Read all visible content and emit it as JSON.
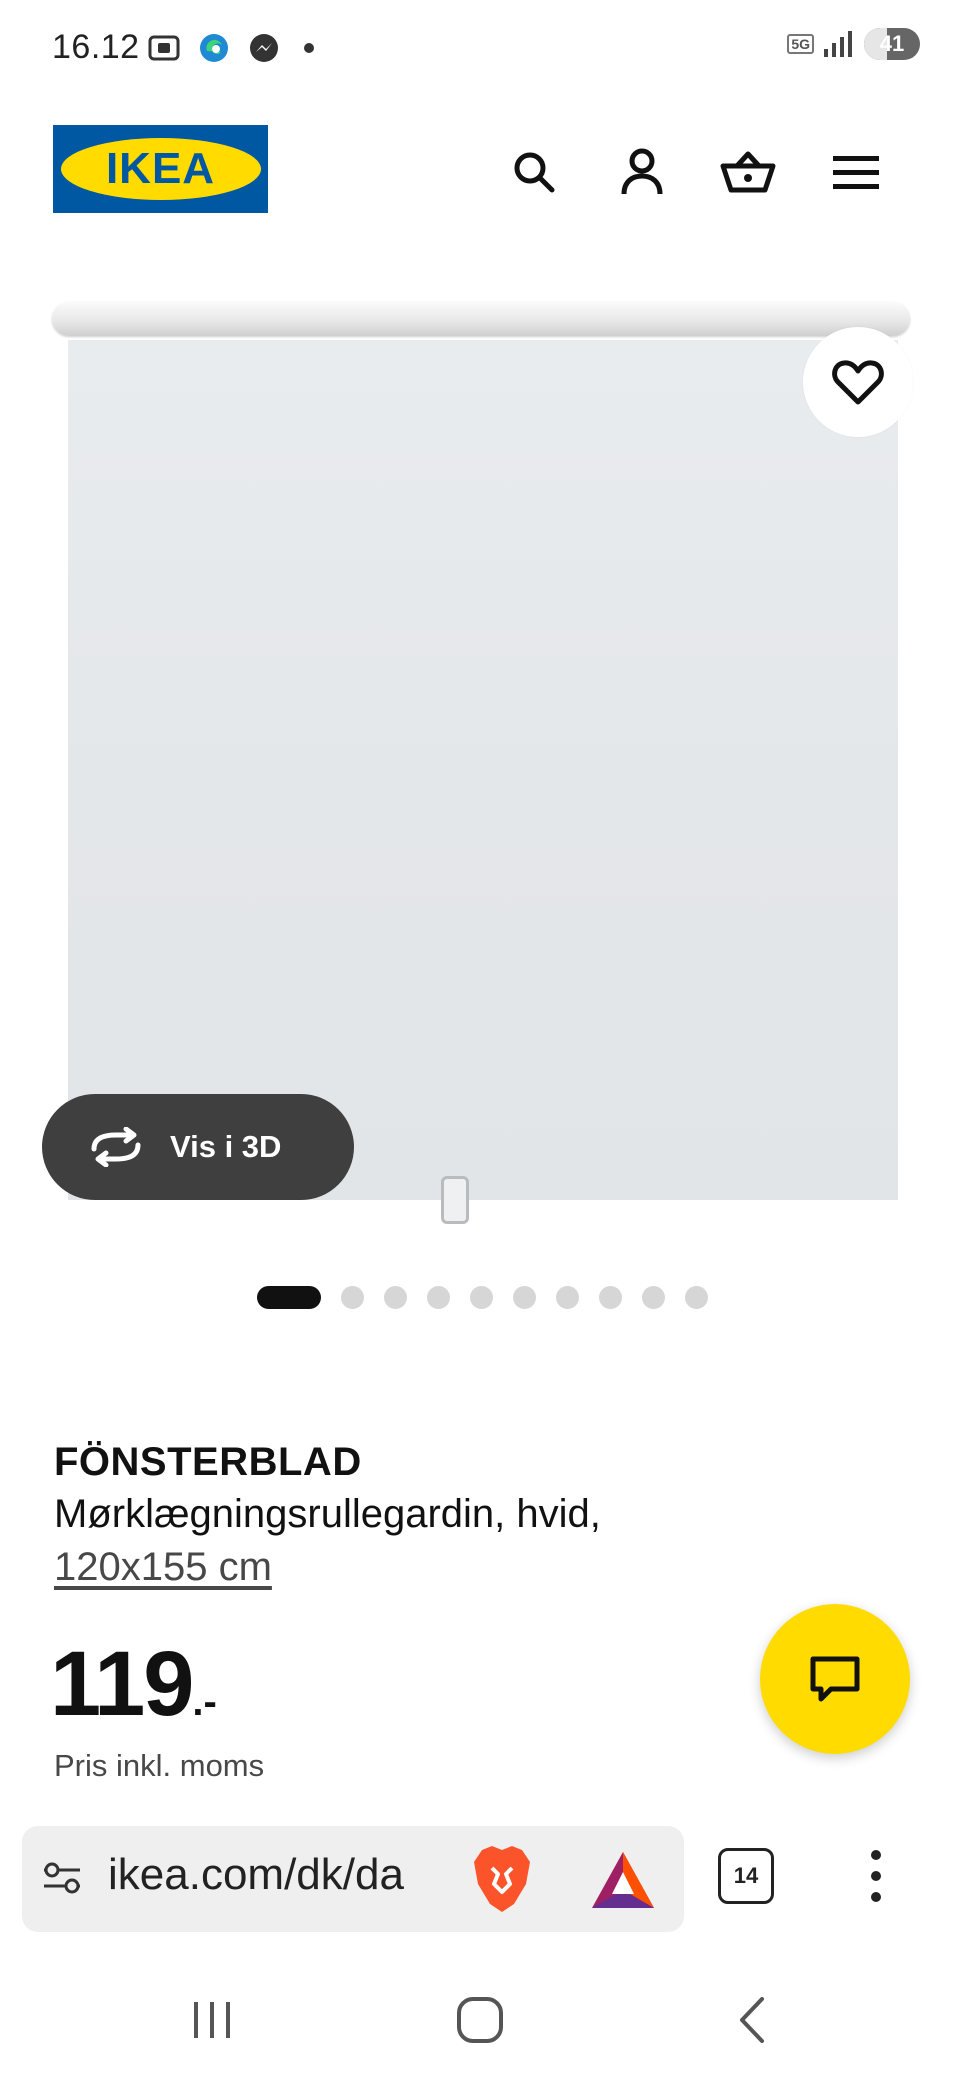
{
  "status_bar": {
    "time": "16.12",
    "network": "5G",
    "battery": "41",
    "battery_level": 0.41
  },
  "header": {
    "logo_text": "IKEA",
    "icons": [
      "search-icon",
      "account-icon",
      "cart-icon",
      "menu-icon"
    ]
  },
  "media": {
    "view3d_label": "Vis i 3D",
    "image_count": 10,
    "active_index": 0
  },
  "product": {
    "name": "FÖNSTERBLAD",
    "description": "Mørklægningsrullegardin, hvid,",
    "size": "120x155 cm",
    "price_integer": "119",
    "price_suffix": ".-",
    "price_note": "Pris inkl. moms"
  },
  "browser": {
    "url": "ikea.com/dk/da",
    "tab_count": "14"
  },
  "colors": {
    "ikea_blue": "#0058a3",
    "ikea_yellow": "#ffdb00",
    "view3d_bg": "#3f3f3f"
  }
}
